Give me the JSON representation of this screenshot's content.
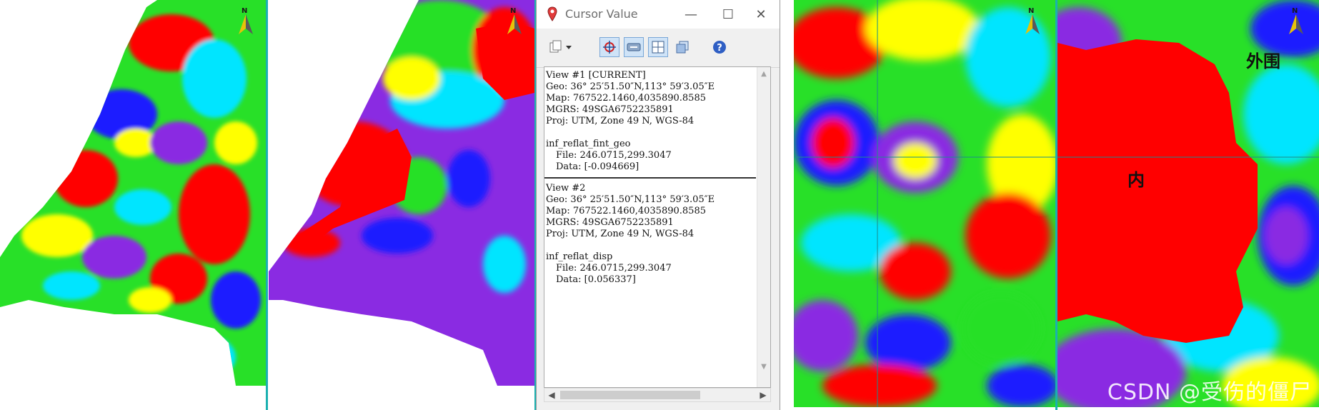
{
  "window": {
    "title": "Cursor Value",
    "controls": {
      "minimize": "—",
      "maximize": "☐",
      "close": "✕"
    },
    "toolbar": [
      "copy-dropdown-icon",
      "crosshair-icon",
      "link-views-icon",
      "grid-icon",
      "stack-icon",
      "help-icon"
    ],
    "views": [
      {
        "header": "View #1 [CURRENT]",
        "geo": "Geo: 36° 25′51.50″N,113° 59′3.05″E",
        "map": "Map: 767522.1460,4035890.8585",
        "mgrs": "MGRS: 49SGA6752235891",
        "proj": "Proj: UTM, Zone 49 N, WGS-84",
        "layer": "inf_reflat_fint_geo",
        "file": "File: 246.0715,299.3047",
        "data": "Data: [-0.094669]"
      },
      {
        "header": "View #2",
        "geo": "Geo: 36° 25′51.50″N,113° 59′3.05″E",
        "map": "Map: 767522.1460,4035890.8585",
        "mgrs": "MGRS: 49SGA6752235891",
        "proj": "Proj: UTM, Zone 49 N, WGS-84",
        "layer": "inf_reflat_disp",
        "file": "File: 246.0715,299.3047",
        "data": "Data: [0.056337]"
      }
    ]
  },
  "panels": {
    "north_label": "N",
    "zoom_right_labels": {
      "outer": "外围",
      "inner": "内"
    },
    "watermark": "CSDN @受伤的僵尸"
  },
  "colors": {
    "red": "#ff0000",
    "purple": "#8a2be2",
    "blue": "#1a1aff",
    "cyan": "#00e5ff",
    "green": "#28e028",
    "yellow": "#ffff00",
    "separator": "#1bb0b0"
  }
}
